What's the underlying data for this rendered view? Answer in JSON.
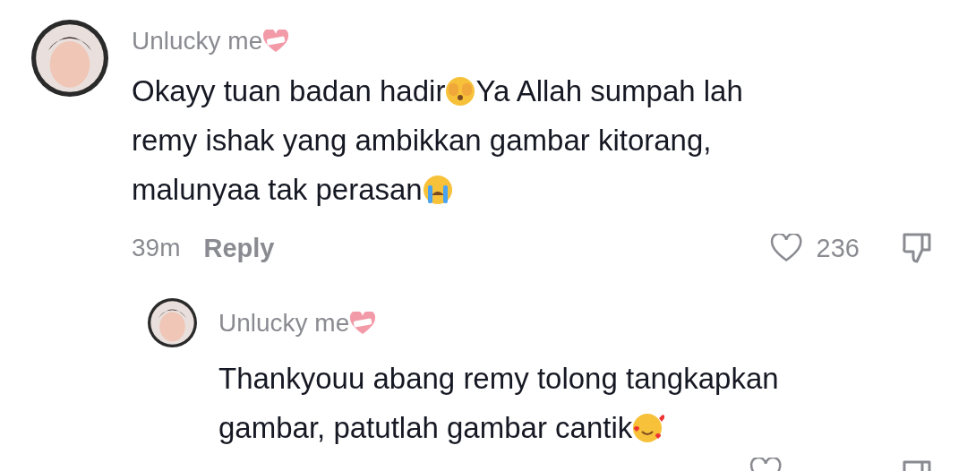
{
  "comments": [
    {
      "author": "Unlucky me",
      "kind": "comment",
      "lines": [
        [
          {
            "kind": "text",
            "text": "Okayy tuan badan hadir"
          },
          {
            "kind": "peek"
          },
          {
            "kind": "text",
            "text": "Ya Allah sumpah lah"
          }
        ],
        [
          {
            "kind": "text",
            "text": "remy ishak yang ambikkan gambar kitorang,"
          }
        ],
        [
          {
            "kind": "text",
            "text": "malunyaa tak perasan"
          },
          {
            "kind": "cry"
          }
        ]
      ],
      "time": "39m",
      "reply": "Reply",
      "likes": "236"
    },
    {
      "author": "Unlucky me",
      "kind": "reply",
      "lines": [
        [
          {
            "kind": "text",
            "text": "Thankyouu abang remy tolong tangkapkan"
          }
        ],
        [
          {
            "kind": "text",
            "text": "gambar, patutlah gambar cantik"
          },
          {
            "kind": "love"
          }
        ]
      ]
    }
  ]
}
